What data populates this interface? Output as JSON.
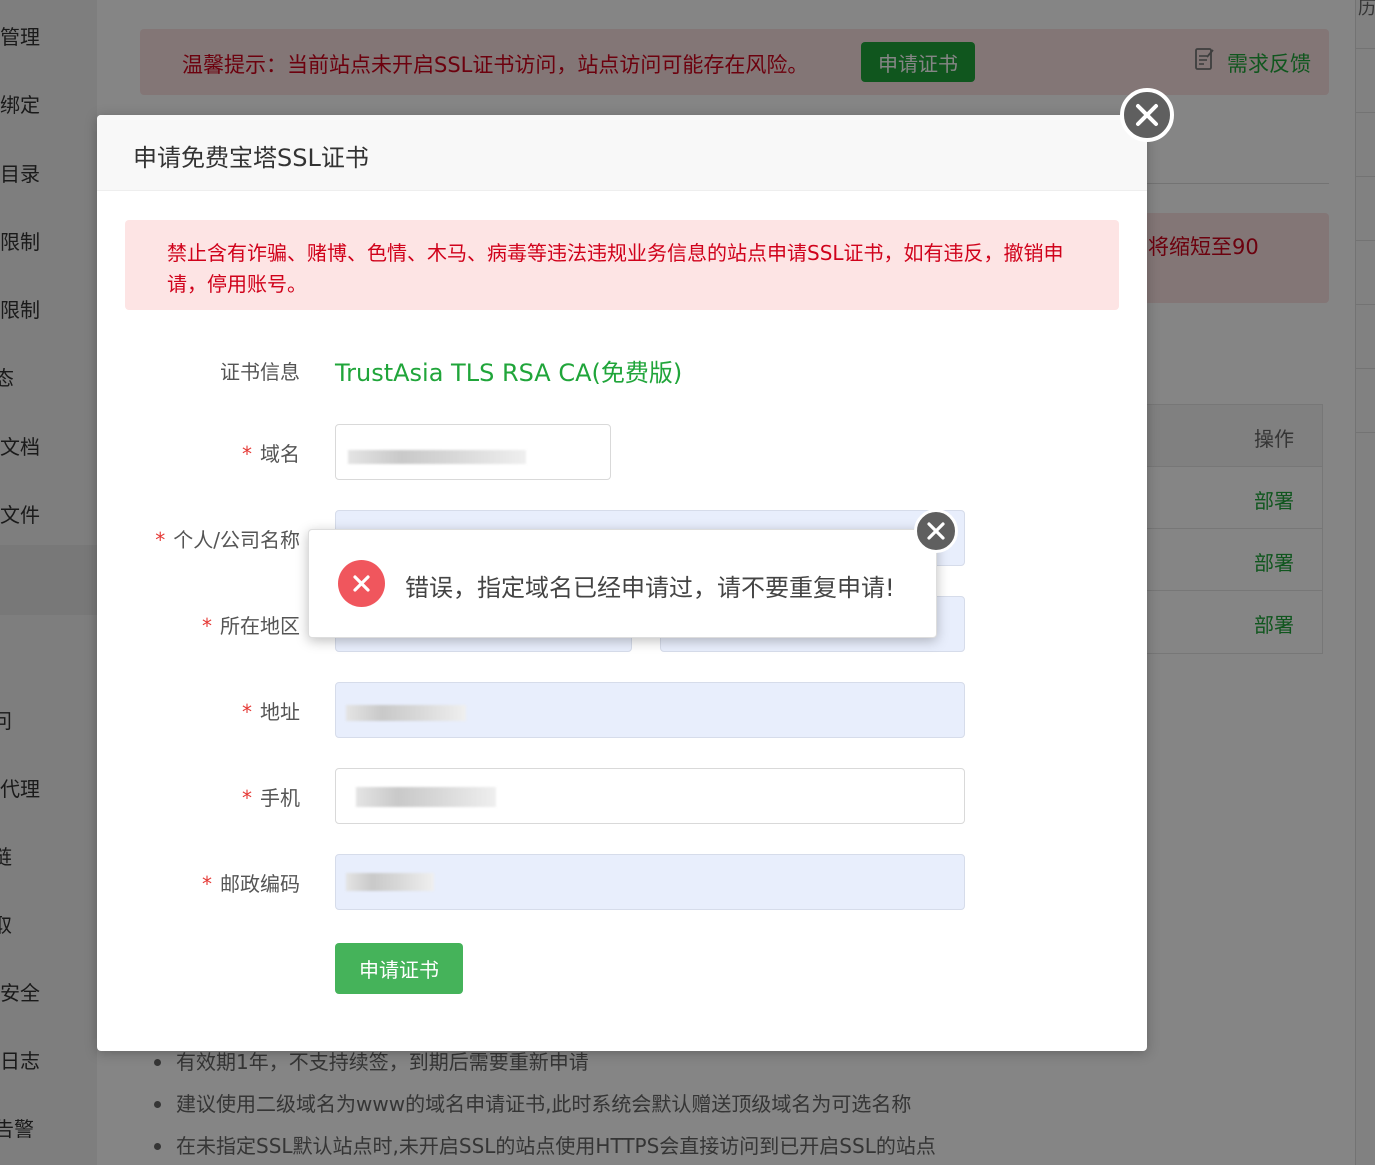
{
  "sidebar": {
    "items": [
      "管理",
      "绑定",
      "目录",
      "限制",
      "限制",
      "态",
      "文档",
      "文件",
      "问",
      "代理",
      "链",
      "取",
      "安全",
      "日志",
      "告警"
    ]
  },
  "top_warning": {
    "text": "温馨提示：当前站点未开启SSL证书访问，站点访问可能存在风险。",
    "apply_button": "申请证书",
    "feedback_label": "需求反馈"
  },
  "secondary_warning": {
    "text": "将缩短至90"
  },
  "bg_table": {
    "header": "操作",
    "rows": [
      "部署",
      "部署",
      "部署"
    ]
  },
  "tips": [
    "有效期1年，不支持续签，到期后需要重新申请",
    "建议使用二级域名为www的域名申请证书,此时系统会默认赠送顶级域名为可选名称",
    "在未指定SSL默认站点时,未开启SSL的站点使用HTTPS会直接访问到已开启SSL的站点"
  ],
  "right_strip": {
    "glyph": "历"
  },
  "modal": {
    "title": "申请免费宝塔SSL证书",
    "alert": "禁止含有诈骗、赌博、色情、木马、病毒等违法违规业务信息的站点申请SSL证书，如有违反，撤销申请，停用账号。",
    "form": {
      "required_mark": "*",
      "cert_info_label": "证书信息",
      "cert_info_value": "TrustAsia TLS RSA CA(免费版)",
      "domain_label": "域名",
      "company_label": "个人/公司名称",
      "region_label": "所在地区",
      "address_label": "地址",
      "phone_label": "手机",
      "postcode_label": "邮政编码"
    },
    "submit_label": "申请证书"
  },
  "toast": {
    "message": "错误，指定域名已经申请过，请不要重复申请!"
  },
  "colors": {
    "brand_green": "#20a53a",
    "error_red": "#d0021b",
    "alert_bg": "#fde4e4",
    "toast_icon": "#f0565d"
  }
}
